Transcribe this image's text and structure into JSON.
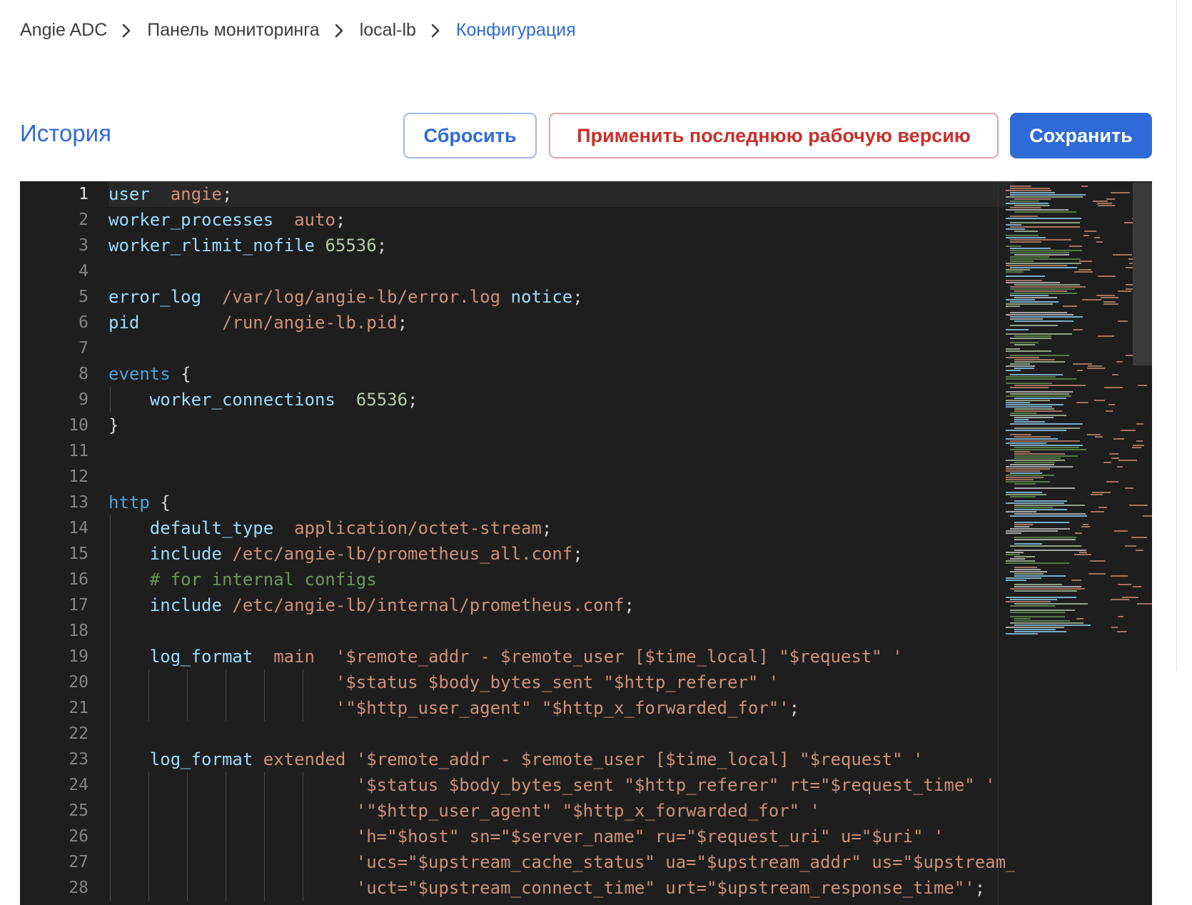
{
  "breadcrumb": {
    "items": [
      "Angie ADC",
      "Панель мониторинга",
      "local-lb",
      "Конфигурация"
    ]
  },
  "header": {
    "title": "История",
    "reset_label": "Сбросить",
    "apply_label": "Применить последнюю рабочую версию",
    "save_label": "Сохранить"
  },
  "colors": {
    "accent": "#2f6bd6",
    "danger": "#c8302a",
    "editor_bg": "#1e1e1e"
  },
  "editor": {
    "line_numbers": [
      "1",
      "2",
      "3",
      "4",
      "5",
      "6",
      "7",
      "8",
      "9",
      "10",
      "11",
      "12",
      "13",
      "14",
      "15",
      "16",
      "17",
      "18",
      "19",
      "20",
      "21",
      "22",
      "23",
      "24",
      "25",
      "26",
      "27",
      "28"
    ],
    "lines": [
      "user  angie;",
      "worker_processes  auto;",
      "worker_rlimit_nofile 65536;",
      "",
      "error_log  /var/log/angie-lb/error.log notice;",
      "pid        /run/angie-lb.pid;",
      "",
      "events {",
      "    worker_connections  65536;",
      "}",
      "",
      "",
      "http {",
      "    default_type  application/octet-stream;",
      "    include /etc/angie-lb/prometheus_all.conf;",
      "    # for internal configs",
      "    include /etc/angie-lb/internal/prometheus.conf;",
      "",
      "    log_format  main  '$remote_addr - $remote_user [$time_local] \"$request\" '",
      "                      '$status $body_bytes_sent \"$http_referer\" '",
      "                      '\"$http_user_agent\" \"$http_x_forwarded_for\"';",
      "",
      "    log_format extended '$remote_addr - $remote_user [$time_local] \"$request\" '",
      "                        '$status $body_bytes_sent \"$http_referer\" rt=\"$request_time\" '",
      "                        '\"$http_user_agent\" \"$http_x_forwarded_for\" '",
      "                        'h=\"$host\" sn=\"$server_name\" ru=\"$request_uri\" u=\"$uri\" '",
      "                        'ucs=\"$upstream_cache_status\" ua=\"$upstream_addr\" us=\"$upstream_status\" '",
      "                        'uct=\"$upstream_connect_time\" urt=\"$upstream_response_time\"';"
    ]
  }
}
